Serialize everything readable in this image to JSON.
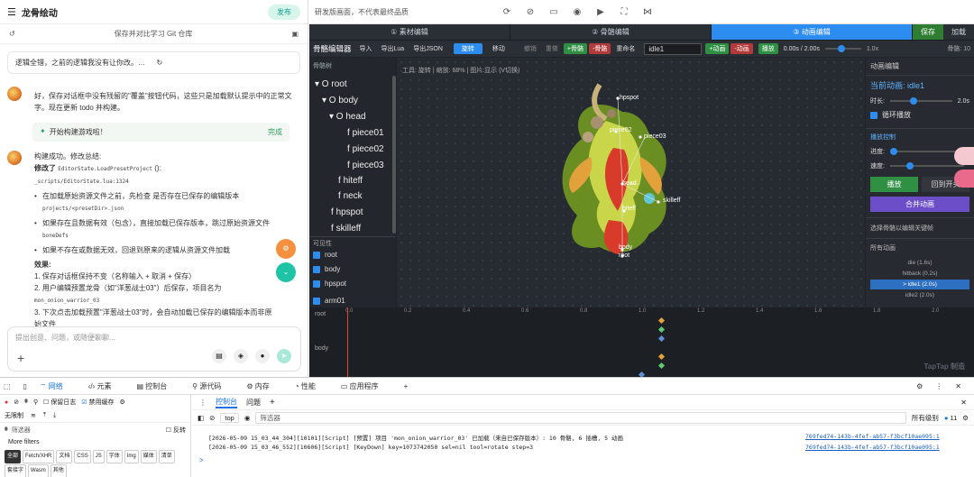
{
  "chat": {
    "title": "龙骨绘动",
    "publish": "发布",
    "subtitle": "保存并对比学习 Git 仓库",
    "last_prompt": "逻辑全错，之前的逻辑我没有让你改。而是先找为什么覆盖不了，并且输入名字输...",
    "reply1": "好，保存对话框中没有残留的\"覆盖\"按钮代码，这些只是加载默认提示中的正常文字。现在更新 todo 并构建。",
    "task_chip": "开始构建游戏啦！",
    "task_status": "完成",
    "r2_intro": "构建成功。修改总结:",
    "r2_changed": "修改了",
    "r2_func": "EditorState.LoadPresetProject",
    "r2_paren": "():",
    "r2_path": "_scripts/EditorState.lua:1324",
    "b1a": "在加载原始资源文件之前，先检查 是否存在已保存的编辑版本",
    "b1b": "projects/<presetDir>.json",
    "b2a": "如果存在且数据有效（包含），直接加载已保存版本，跳过原始资源文件",
    "b2b": "boneDefs",
    "b3": "如果不存在或数据无效，回退到原来的逻辑从资源文件加载",
    "effect": "效果:",
    "n1": "1. 保存对话框保持不变（名称输入 + 取消 + 保存）",
    "n2": "2. 用户编辑预置龙骨（如\"洋葱战士03\"）后保存，项目名为",
    "n2b": "mon_onion_warrior_03",
    "n3": "3. 下次点击加载预置\"洋葱战士03\"时，会自动加载已保存的编辑版本而非原始文件",
    "input_placeholder": "提出创意、问题，或随便聊聊..."
  },
  "editor": {
    "top_hint": "研发版画面，不代表最终品质",
    "tabs": [
      "① 素材编辑",
      "② 骨骼编辑",
      "③ 动画编辑"
    ],
    "save": "保存",
    "load": "加载",
    "toolbar": {
      "title": "骨骼编辑器",
      "import": "导入",
      "export_lua": "导出Lua",
      "export_json": "导出JSON",
      "rotate": "旋转",
      "move": "移动",
      "undo": "撤销",
      "redo": "重做",
      "add_bone": "+骨骼",
      "del_bone": "-骨骼",
      "rename": "重命名",
      "anim_select": "idle1",
      "add_anim": "+动画",
      "del_anim": "-动画",
      "play": "播放",
      "time": "0.00s / 2.00s",
      "speed": "1.0x",
      "bone_count": "骨骼: 10"
    },
    "tree_header": "骨骼树",
    "bones": [
      "root",
      "body",
      "head",
      "piece01",
      "piece02",
      "piece03",
      "hiteff",
      "neck",
      "hpspot",
      "skilleff"
    ],
    "visibility_header": "可见性",
    "visible": [
      "root",
      "body",
      "hpspot",
      "arm01"
    ],
    "canvas_hint": "工具: 旋转 | 缩放: 68% | 图片:显示 (V切换)",
    "canvas_bone_labels": [
      "hpspot",
      "piece02",
      "piece03",
      "head",
      "skilleff",
      "hiteff",
      "body",
      "root",
      "piece01"
    ],
    "watermark": "TapTap 制造",
    "right_panel": {
      "header": "动画编辑",
      "current": "当前动画: idle1",
      "duration_label": "时长:",
      "duration_val": "2.0s",
      "loop": "循环播放",
      "playback": "播放控制",
      "progress": "进度:",
      "speed": "速度:",
      "play_btn": "播放",
      "back_btn": "回到开头",
      "merge_btn": "合并动画",
      "select_hint": "选择骨骼以编辑关键帧",
      "all_anims": "所有动画",
      "anims": [
        "die (1.6s)",
        "hitback (0.2s)",
        "> idle1 (2.0s)",
        "idle2 (2.0s)"
      ]
    },
    "timeline": {
      "ticks": [
        "0.0",
        "0.2",
        "0.4",
        "0.6",
        "0.8",
        "1.0",
        "1.2",
        "1.4",
        "1.6",
        "1.8",
        "2.0"
      ],
      "tracks": [
        "root",
        "body"
      ]
    }
  },
  "devtools": {
    "tabs": [
      "网络",
      "元素",
      "控制台",
      "源代码",
      "内存",
      "性能",
      "应用程序"
    ],
    "preserve_log": "保留日志",
    "disable_cache": "禁用缓存",
    "throttle": "无限制",
    "filter": "筛选器",
    "invert": "反转",
    "more_filters": "More filters",
    "type_chips": [
      "全部",
      "Fetch/XHR",
      "文档",
      "CSS",
      "JS",
      "字体",
      "Img",
      "媒体",
      "清单",
      "套接字",
      "Wasm",
      "其他"
    ],
    "console_tabs": [
      "控制台",
      "问题"
    ],
    "context": "top",
    "level": "所有级别",
    "issues": "11",
    "logs": [
      {
        "text": "[2026-05-09 15_03_44_304][10101][Script] [预置] 项目 'mon_onion_warrior_03' 已加载（来自已保存版本）: 10 骨骼, 6 插槽, 5 动画",
        "src": "769fed74-143b-4fef-ab57-f3bcf10ae095:1"
      },
      {
        "text": "[2026-05-09 15_03_46_552][10606][Script] [KeyDown] key=1073742050 sel=nil tool=rotate step=3",
        "src": "769fed74-143b-4fef-ab57-f3bcf10ae095:1"
      }
    ],
    "prompt": ">"
  }
}
